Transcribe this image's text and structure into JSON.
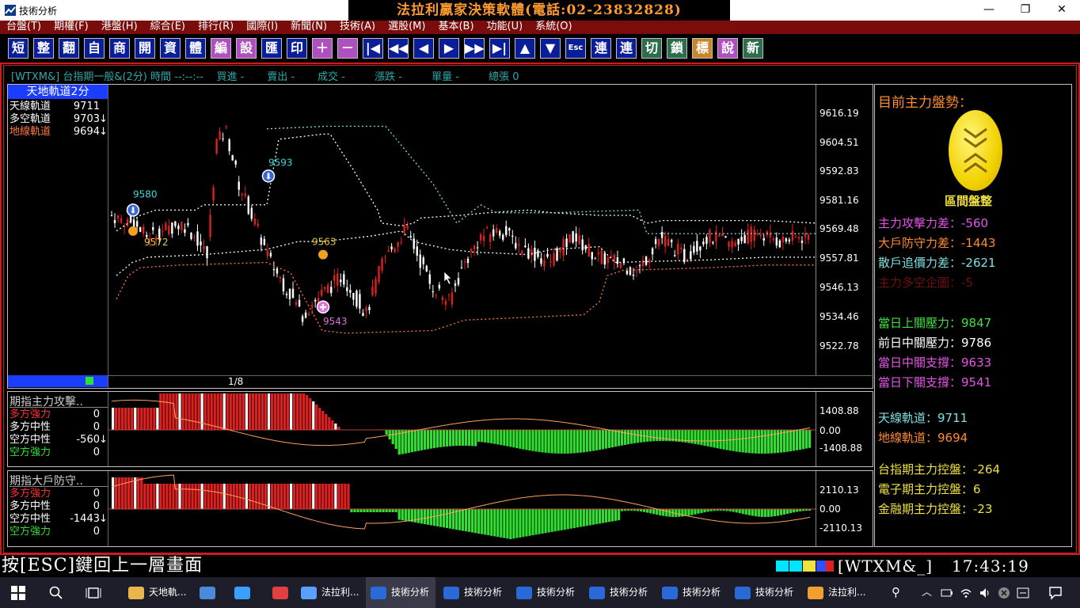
{
  "window": {
    "title": "技術分析",
    "banner": "法拉利贏家決策軟體(電話:02-23832828)"
  },
  "window_controls": {
    "minimize": "—",
    "restore": "❐",
    "close": "✕"
  },
  "menu": [
    "台盤(T)",
    "期權(F)",
    "港盤(H)",
    "綜合(E)",
    "排行(R)",
    "國際(I)",
    "新聞(N)",
    "技術(A)",
    "選股(M)",
    "基本(B)",
    "功能(U)",
    "系統(O)"
  ],
  "toolbar": [
    "短",
    "整",
    "翻",
    "自",
    "商",
    "開",
    "資",
    "體",
    "編",
    "設",
    "匯",
    "印",
    "＋",
    "－",
    "|◀",
    "◀◀",
    "◀",
    "▶",
    "▶▶",
    "▶|",
    "▲",
    "▼",
    "Esc",
    "連",
    "連",
    "切",
    "鎖",
    "標",
    "說",
    "新"
  ],
  "infobar": "[WTXM&] 台指期一般&(2分) 時間 --:--:--    買進 -       賣出 -       成交 -         漲跌 -         單量 -         總張 0",
  "main_chart": {
    "legend_title": "天地軌道2分",
    "legend": [
      {
        "label": "天線軌道",
        "value": "9711",
        "arrow": "",
        "color": "#ffffff"
      },
      {
        "label": "多空軌道",
        "value": "9703",
        "arrow": "↓",
        "color": "#ffffff"
      },
      {
        "label": "地線軌道",
        "value": "9694",
        "arrow": "↓",
        "color": "#ff7a3d"
      }
    ],
    "page": "1/8",
    "y_ticks": [
      "9616.19",
      "9604.51",
      "9592.83",
      "9581.16",
      "9569.48",
      "9557.81",
      "9546.13",
      "9534.46",
      "9522.78"
    ],
    "markers": [
      {
        "label": "9580",
        "color": "#3bd7d7"
      },
      {
        "label": "9572",
        "color": "#e8c93a"
      },
      {
        "label": "9593",
        "color": "#3bd7d7"
      },
      {
        "label": "9563",
        "color": "#e8c93a"
      },
      {
        "label": "9543",
        "color": "#e070e0"
      }
    ]
  },
  "sub1": {
    "title": "期指主力攻擊..",
    "legend": [
      {
        "label": "多方強力",
        "value": "0",
        "arrow": "",
        "color": "#ff3030"
      },
      {
        "label": "多方中性",
        "value": "0",
        "arrow": "",
        "color": "#ffffff"
      },
      {
        "label": "空方中性",
        "value": "-560",
        "arrow": "↓",
        "color": "#ffffff"
      },
      {
        "label": "空方強力",
        "value": "0",
        "arrow": "",
        "color": "#30e030"
      }
    ],
    "y_ticks": [
      "1408.88",
      "0.00",
      "-1408.88"
    ]
  },
  "sub2": {
    "title": "期指大戶防守..",
    "legend": [
      {
        "label": "多方強力",
        "value": "0",
        "arrow": "",
        "color": "#ff3030"
      },
      {
        "label": "多方中性",
        "value": "0",
        "arrow": "",
        "color": "#ffffff"
      },
      {
        "label": "空方中性",
        "value": "-1443",
        "arrow": "↓",
        "color": "#ffffff"
      },
      {
        "label": "空方強力",
        "value": "0",
        "arrow": "",
        "color": "#30e030"
      }
    ],
    "y_ticks": [
      "2110.13",
      "0.00",
      "-2110.13"
    ]
  },
  "right_panel": {
    "heading": "目前主力盤勢：",
    "badge_label": "區間盤整",
    "group1": [
      {
        "text": "主力攻擊力差：-560",
        "color": "#e455e4"
      },
      {
        "text": "大戶防守力差：-1443",
        "color": "#ff8c2e"
      },
      {
        "text": "散戶追價力差：-2621",
        "color": "#7fe0e0"
      },
      {
        "text": "主力多空企圖：-5",
        "color": "#6e1010"
      }
    ],
    "group2": [
      {
        "text": "當日上關壓力：9847",
        "color": "#40e040"
      },
      {
        "text": "前日中關壓力：9786",
        "color": "#ffffff"
      },
      {
        "text": "當日中關支撐：9633",
        "color": "#e455e4"
      },
      {
        "text": "當日下關支撐：9541",
        "color": "#e455e4"
      }
    ],
    "group3": [
      {
        "text": "天線軌道：9711",
        "color": "#7fe0e0"
      },
      {
        "text": "地線軌道：9694",
        "color": "#ff8c2e"
      }
    ],
    "group4": [
      {
        "text": "台指期主力控盤：-264",
        "color": "#f0e040"
      },
      {
        "text": "電子期主力控盤：6",
        "color": "#f0e040"
      },
      {
        "text": "金融期主力控盤：-23",
        "color": "#f0e040"
      }
    ]
  },
  "status": {
    "command": "按[ESC]鍵回上一層畫面",
    "symbol": "[WTXM&_]",
    "time": "17:43:19"
  },
  "taskbar": [
    {
      "label": "天地軌...",
      "active": false
    },
    {
      "label": "",
      "active": false
    },
    {
      "label": "",
      "active": false
    },
    {
      "label": "",
      "active": false
    },
    {
      "label": "法拉利...",
      "active": false
    },
    {
      "label": "技術分析",
      "active": true
    },
    {
      "label": "技術分析",
      "active": false
    },
    {
      "label": "技術分析",
      "active": false
    },
    {
      "label": "技術分析",
      "active": false
    },
    {
      "label": "技術分析",
      "active": false
    },
    {
      "label": "技術分析",
      "active": false
    },
    {
      "label": "法拉利...",
      "active": false
    }
  ],
  "colors": {
    "frame": "#cc1c1c",
    "menu_bg": "#7a0c0c",
    "up": "#e02020",
    "down": "#ffffff",
    "bull_bar": "#e02020",
    "bear_bar": "#30e030"
  }
}
